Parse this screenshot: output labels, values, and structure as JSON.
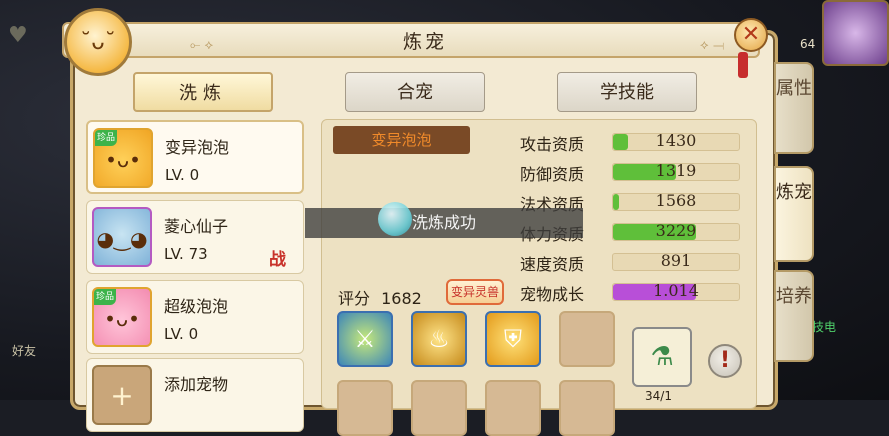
{
  "window": {
    "title": "炼宠"
  },
  "background": {
    "left_label": "好友",
    "counter": "64",
    "right_text": "技电"
  },
  "tabs": [
    {
      "label": "洗炼",
      "active": true
    },
    {
      "label": "合宠",
      "active": false
    },
    {
      "label": "学技能",
      "active": false
    }
  ],
  "side_tabs": [
    {
      "label": "属性",
      "active": false
    },
    {
      "label": "炼宠",
      "active": true
    },
    {
      "label": "培养",
      "active": false
    }
  ],
  "pets": [
    {
      "name": "变异泡泡",
      "level": "LV. 0",
      "badge": "珍品",
      "battle": ""
    },
    {
      "name": "菱心仙子",
      "level": "LV. 73",
      "badge": "",
      "battle": "战"
    },
    {
      "name": "超级泡泡",
      "level": "LV. 0",
      "badge": "珍品",
      "battle": ""
    },
    {
      "name": "添加宠物",
      "level": "",
      "badge": "",
      "battle": ""
    }
  ],
  "detail": {
    "pet_type": "变异泡泡",
    "stats": [
      {
        "label": "攻击资质",
        "value": "1430",
        "fill": 0.12,
        "color": "#5fbf3a"
      },
      {
        "label": "防御资质",
        "value": "1319",
        "fill": 0.5,
        "color": "#5fbf3a"
      },
      {
        "label": "法术资质",
        "value": "1568",
        "fill": 0.05,
        "color": "#5fbf3a"
      },
      {
        "label": "体力资质",
        "value": "3229",
        "fill": 0.66,
        "color": "#5fbf3a"
      },
      {
        "label": "速度资质",
        "value": "891",
        "fill": 0.0,
        "color": "#5fbf3a"
      },
      {
        "label": "宠物成长",
        "value": "1.014",
        "fill": 0.66,
        "color": "#b84fd8"
      }
    ],
    "score_label": "评分",
    "score_value": "1682",
    "mutant_badge": "变异灵兽",
    "toast": "洗炼成功",
    "item_count": "34/1"
  },
  "colors": {
    "panel_bg": "#f3ead3",
    "accent_gold": "#c4a46a",
    "stat_green": "#5fbf3a",
    "growth_purple": "#b84fd8"
  }
}
